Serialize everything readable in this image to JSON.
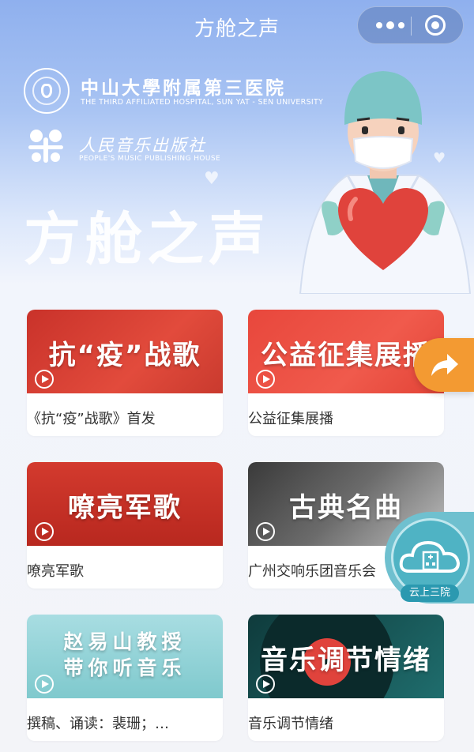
{
  "navbar": {
    "title": "方舱之声"
  },
  "banner": {
    "hospital_cn": "中山大學附属第三医院",
    "hospital_en": "THE THIRD AFFILIATED HOSPITAL, SUN YAT - SEN UNIVERSITY",
    "publisher_cn": "人民音乐出版社",
    "publisher_en": "PEOPLE'S MUSIC PUBLISHING HOUSE",
    "title": "方舱之声"
  },
  "cards": [
    {
      "thumb_title": "抗“疫”战歌",
      "caption": "《抗“疫”战歌》首发"
    },
    {
      "thumb_title": "公益征集展播",
      "caption": "公益征集展播"
    },
    {
      "thumb_title": "嘹亮军歌",
      "caption": "嘹亮军歌"
    },
    {
      "thumb_title": "古典名曲",
      "caption": "广州交响乐团音乐会"
    },
    {
      "thumb_title_line1": "赵易山教授",
      "thumb_title_line2": "带你听音乐",
      "caption": "撰稿、诵读：裴珊；…"
    },
    {
      "thumb_title": "音乐调节情绪",
      "caption": "音乐调节情绪"
    }
  ],
  "floating": {
    "cloud_label": "云上三院"
  },
  "colors": {
    "orange": "#f39a32",
    "teal": "#4fb3c4",
    "red": "#e24b3c"
  },
  "icons": [
    "more-icon",
    "close-circle-icon",
    "play-icon",
    "share-icon",
    "cloud-hospital-icon"
  ]
}
